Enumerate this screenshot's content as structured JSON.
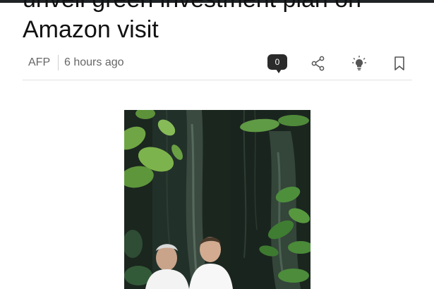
{
  "article": {
    "headline": "unveil green investment plan on\nAmazon visit",
    "source": "AFP",
    "time_ago": "6 hours ago",
    "comment_count": "0"
  },
  "icons": {
    "comment": "comment-bubble-icon",
    "share": "share-icon",
    "insight": "lightbulb-icon",
    "bookmark": "bookmark-icon"
  },
  "colors": {
    "headline_text": "#111111",
    "meta_text": "#666666",
    "badge_bg": "#2b2b2b",
    "top_bar": "#1f2326"
  }
}
